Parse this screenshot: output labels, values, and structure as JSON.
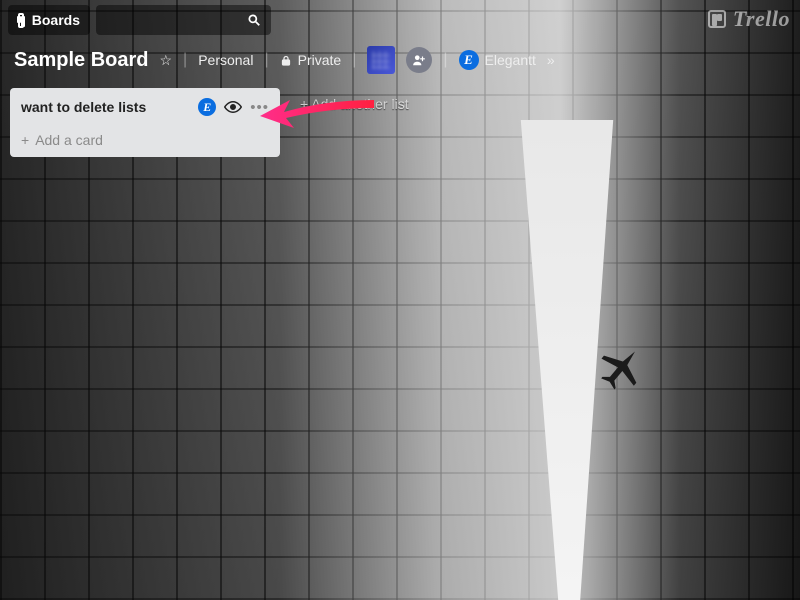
{
  "brand": {
    "name": "Trello"
  },
  "topbar": {
    "boards_label": "Boards"
  },
  "board": {
    "name": "Sample Board",
    "team": "Personal",
    "visibility": "Private",
    "powerup_label": "Elegantt"
  },
  "lists": [
    {
      "title": "want to delete lists",
      "add_card_label": "Add a card"
    }
  ],
  "add_list_label": "Add another list",
  "icons": {
    "elegantt_glyph": "E",
    "add_user_glyph": "⊕"
  }
}
